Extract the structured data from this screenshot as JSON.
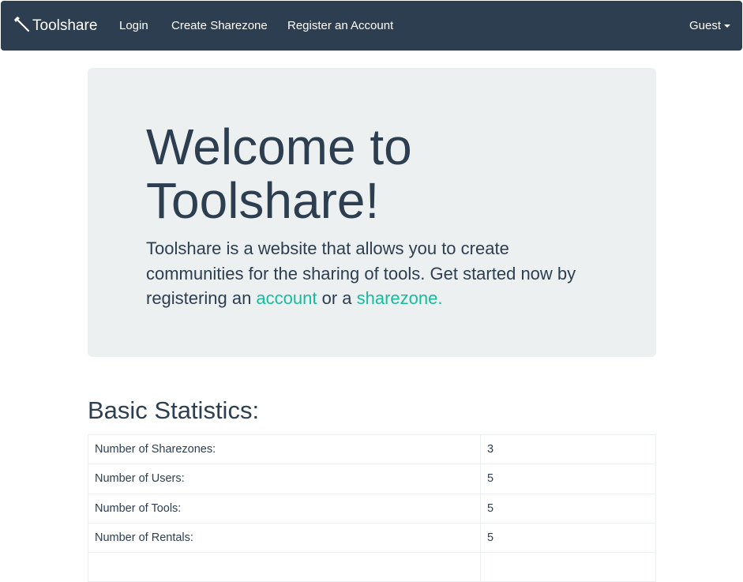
{
  "navbar": {
    "brand": "Toolshare",
    "brand_icon": "hammer-icon",
    "links": {
      "login": "Login",
      "create_sharezone": "Create Sharezone",
      "register": "Register an Account"
    },
    "user_menu": "Guest"
  },
  "jumbotron": {
    "title": "Welcome to Toolshare!",
    "text_before": "Toolshare is a website that allows you to create communities for the sharing of tools. Get started now by registering an ",
    "link_account": "account",
    "text_middle": " or a ",
    "link_sharezone": "sharezone."
  },
  "stats": {
    "title": "Basic Statistics:",
    "rows": [
      {
        "label": "Number of Sharezones:",
        "value": "3"
      },
      {
        "label": "Number of Users:",
        "value": "5"
      },
      {
        "label": "Number of Tools:",
        "value": "5"
      },
      {
        "label": "Number of Rentals:",
        "value": "5"
      },
      {
        "label": "",
        "value": ""
      }
    ]
  },
  "colors": {
    "navbar_bg": "#2c3e50",
    "jumbotron_bg": "#ecf0f1",
    "link": "#18bc9c",
    "text": "#2c3e50"
  }
}
